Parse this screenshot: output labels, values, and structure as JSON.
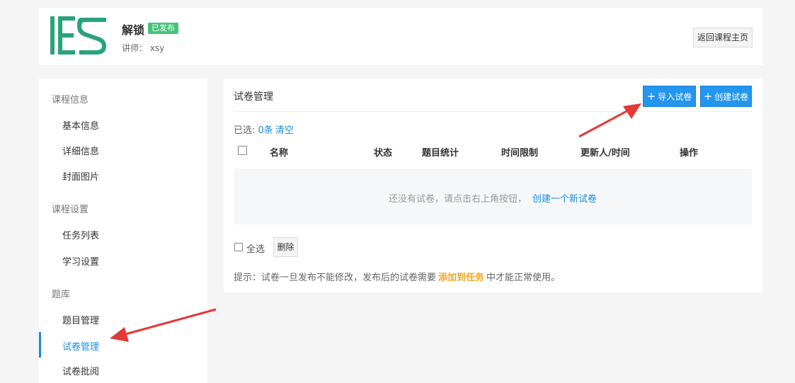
{
  "header": {
    "title": "解锁",
    "status": "已发布",
    "teacher": "讲师： xsy",
    "back_label": "返回课程主页"
  },
  "sidebar": {
    "groups": [
      {
        "label": "课程信息",
        "items": [
          "基本信息",
          "详细信息",
          "封面图片"
        ]
      },
      {
        "label": "课程设置",
        "items": [
          "任务列表",
          "学习设置"
        ]
      },
      {
        "label": "题库",
        "items": [
          "题目管理",
          "试卷管理",
          "试卷批阅"
        ]
      }
    ],
    "active_item": "试卷管理"
  },
  "main": {
    "title": "试卷管理",
    "import_label": "导入试卷",
    "create_label": "创建试卷",
    "selected_prefix": "已选:",
    "selected_count": "0条",
    "clear_label": "清空",
    "columns": [
      "名称",
      "状态",
      "题目统计",
      "时间限制",
      "更新人/时间",
      "操作"
    ],
    "empty_text": "还没有试卷，请点击右上角按钮，",
    "empty_link": "创建一个新试卷",
    "select_all_label": "全选",
    "delete_label": "删除",
    "tip_prefix": "提示：试卷一旦发布不能修改，发布后的试卷需要",
    "tip_link": "添加到任务",
    "tip_suffix": "中才能正常使用。"
  },
  "colors": {
    "accent": "#1a8cde",
    "button_blue": "#2396ef",
    "badge_green": "#46c37b",
    "tip_orange": "#f5a623",
    "annotation_red": "#e53935",
    "logo_green": "#2aa37a"
  }
}
